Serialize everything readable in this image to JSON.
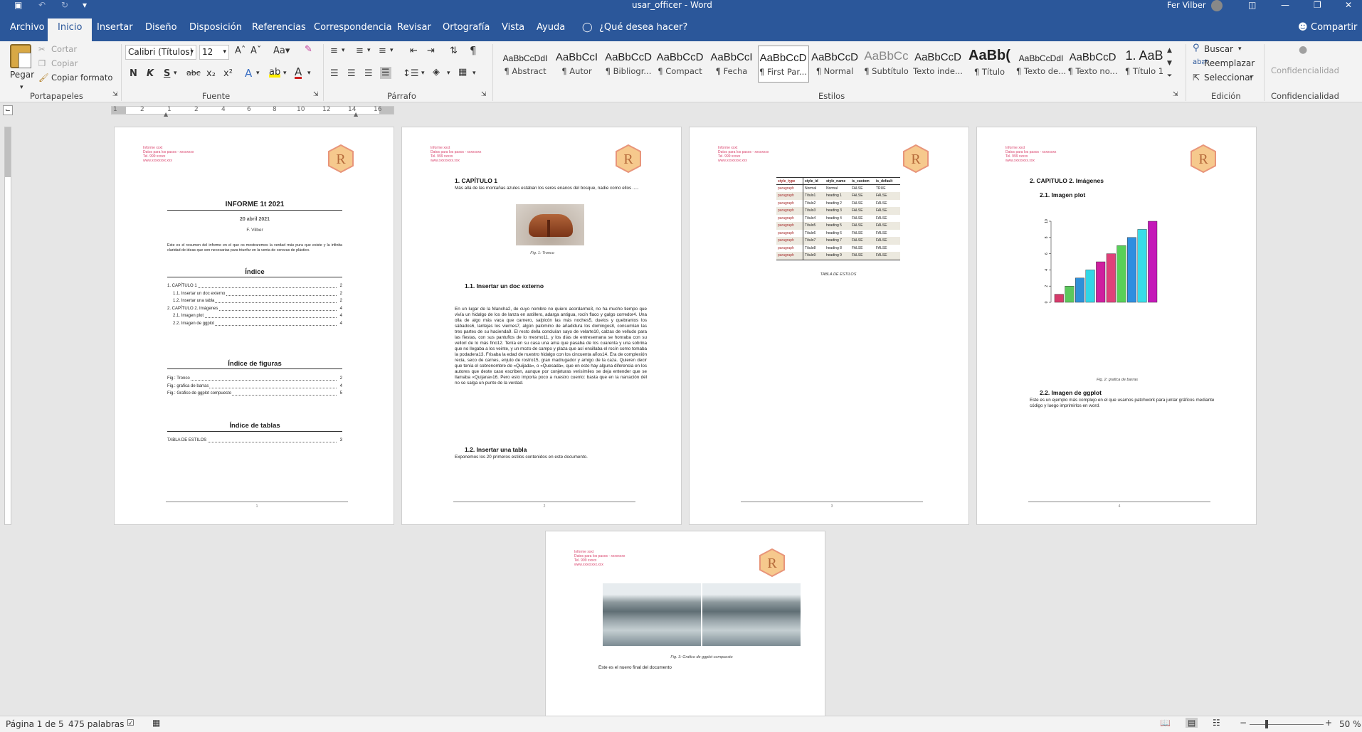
{
  "window": {
    "title": "usar_officer - Word",
    "user": "Fer Vilber"
  },
  "tabs": [
    "Archivo",
    "Inicio",
    "Insertar",
    "Diseño",
    "Disposición",
    "Referencias",
    "Correspondencia",
    "Revisar",
    "Ortografía",
    "Vista",
    "Ayuda"
  ],
  "tell_me": "¿Qué desea hacer?",
  "share": "Compartir",
  "clipboard": {
    "paste": "Pegar",
    "cut": "Cortar",
    "copy": "Copiar",
    "format_painter": "Copiar formato",
    "group": "Portapapeles"
  },
  "font": {
    "name": "Calibri (Títulos)",
    "size": "12",
    "group": "Fuente",
    "bold": "N",
    "italic": "K",
    "underline": "S",
    "strike": "abc",
    "sub": "x₂",
    "sup": "x²"
  },
  "paragraph": {
    "group": "Párrafo"
  },
  "styles": {
    "group": "Estilos",
    "items": [
      {
        "sample": "AaBbCcDdI",
        "name": "¶ Abstract"
      },
      {
        "sample": "AaBbCcI",
        "name": "¶ Autor"
      },
      {
        "sample": "AaBbCcD",
        "name": "¶ Bibliogr..."
      },
      {
        "sample": "AaBbCcD",
        "name": "¶ Compact"
      },
      {
        "sample": "AaBbCcI",
        "name": "¶ Fecha"
      },
      {
        "sample": "AaBbCcD",
        "name": "¶ First Par..."
      },
      {
        "sample": "AaBbCcD",
        "name": "¶ Normal"
      },
      {
        "sample": "AaBbCc",
        "name": "¶ Subtítulo"
      },
      {
        "sample": "AaBbCcD",
        "name": "Texto inde..."
      },
      {
        "sample": "AaBb(",
        "name": "¶ Título"
      },
      {
        "sample": "AaBbCcDdI",
        "name": "¶ Texto de..."
      },
      {
        "sample": "AaBbCcD",
        "name": "¶ Texto no..."
      },
      {
        "sample": "1. AaB",
        "name": "¶ Título 1"
      }
    ]
  },
  "editing": {
    "find": "Buscar",
    "replace": "Reemplazar",
    "select": "Seleccionar",
    "group": "Edición"
  },
  "confidentiality": {
    "label": "Confidencialidad",
    "group": "Confidencialidad"
  },
  "ruler": {
    "marks": [
      "1",
      "2",
      "1",
      "2",
      "4",
      "6",
      "8",
      "10",
      "12",
      "14",
      "16"
    ]
  },
  "doc_header": [
    "Informe xxxt",
    "Datos para los pasos - xxxxxxxx",
    "Tel. 999 xxxxx",
    "www.xxxxxxxx.xxx"
  ],
  "page1": {
    "title": "INFORME 1t 2021",
    "date": "20 abril 2021",
    "author": "F. Vilber",
    "abstract": "Este es el resumen del informe en el que os mostraremos la verdad más pura que existe y la infinita claridad de ideas que son necesarias para triunfar en la venta de cerezas de plástico.",
    "index_title": "Índice",
    "toc": [
      {
        "text": "1.   CAPÍTULO 1",
        "page": "2"
      },
      {
        "text": "1.1.   Insertar un doc externo",
        "page": "2"
      },
      {
        "text": "1.2.   Insertar una tabla",
        "page": "2"
      },
      {
        "text": "2.   CAPÍTULO 2. Imágenes",
        "page": "4"
      },
      {
        "text": "2.1.   Imagen plot",
        "page": "4"
      },
      {
        "text": "2.2.   Imagen de ggplot",
        "page": "4"
      }
    ],
    "fig_index_title": "Índice de figuras",
    "figs": [
      {
        "text": "Fig.: Tronco",
        "page": "2"
      },
      {
        "text": "Fig.: grafica de barras",
        "page": "4"
      },
      {
        "text": "Fig.: Grafico de ggplot compuesto",
        "page": "5"
      }
    ],
    "table_index_title": "Índice de tablas",
    "tables": [
      {
        "text": "TABLA DE ESTILOS",
        "page": "3"
      }
    ],
    "page_num": "1"
  },
  "page2": {
    "h1": "1.   CAPÍTULO 1",
    "intro": "Más allá de las montañas azules estaban los seres enanos del bosque, nadie como ellos .....",
    "fig_caption": "Fig. 1: Tronco",
    "h11": "1.1.        Insertar un doc externo",
    "body": "En un lugar de la Mancha2, de cuyo nombre no quiero acordarme3, no ha mucho tiempo que vivía un hidalgo de los de lanza en astillero, adarga antigua, rocín flaco y galgo corredor4. Una olla de algo más vaca que carnero, salpicón las más noches5, duelos y quebrantos los sábados6, lantejas los viernes7, algún palomino de añadidura los domingos8, consumían las tres partes de su hacienda9. El resto della concluían sayo de velarte10, calzas de velludo para las fiestas, con sus pantuflos de lo mesmo11, y los días de entresemana se honraba con su vellorí de lo más fino12. Tenía en su casa una ama que pasaba de los cuarenta y una sobrina que no llegaba a los veinte, y un mozo de campo y plaza que así ensillaba el rocín como tomaba la podadera13. Frisaba la edad de nuestro hidalgo con los cincuenta años14. Era de complexión recia, seco de carnes, enjuto de rostro15, gran madrugador y amigo de la caza. Quieren decir que tenía el sobrenombre de «Quijada», o «Quesada», que en esto hay alguna diferencia en los autores que deste caso escriben, aunque por conjeturas verisímiles se deja entender que se llamaba «Quijana»16. Pero esto importa poco a nuestro cuento: basta que en la narración dél no se salga un punto de la verdad.",
    "h12": "1.2.        Insertar una tabla",
    "h12_text": "Exponemos los 20 primeros estilos contenidos en este documento.",
    "page_num": "2"
  },
  "page3": {
    "headers": [
      "style_type",
      "style_id",
      "style_name",
      "is_custom",
      "is_default"
    ],
    "rows": [
      [
        "paragraph",
        "Normal",
        "Normal",
        "FALSE",
        "TRUE"
      ],
      [
        "paragraph",
        "Título1",
        "heading 1",
        "FALSE",
        "FALSE"
      ],
      [
        "paragraph",
        "Título2",
        "heading 2",
        "FALSE",
        "FALSE"
      ],
      [
        "paragraph",
        "Título3",
        "heading 3",
        "FALSE",
        "FALSE"
      ],
      [
        "paragraph",
        "Título4",
        "heading 4",
        "FALSE",
        "FALSE"
      ],
      [
        "paragraph",
        "Título5",
        "heading 5",
        "FALSE",
        "FALSE"
      ],
      [
        "paragraph",
        "Título6",
        "heading 6",
        "FALSE",
        "FALSE"
      ],
      [
        "paragraph",
        "Título7",
        "heading 7",
        "FALSE",
        "FALSE"
      ],
      [
        "paragraph",
        "Título8",
        "heading 8",
        "FALSE",
        "FALSE"
      ],
      [
        "paragraph",
        "Título9",
        "heading 9",
        "FALSE",
        "FALSE"
      ]
    ],
    "caption": "TABLA DE ESTILOS",
    "page_num": "3"
  },
  "page4": {
    "h2": "2.   CAPITULO 2. Imágenes",
    "h21": "2.1.        Imagen plot",
    "fig_caption": "Fig. 2: grafica de barras",
    "h22": "2.2.        Imagen de ggplot",
    "h22_text": "Este es un ejemplo más complejo en el que usamos patchwork para juntar gráficos mediante código y luego imprimirlos en word.",
    "page_num": "4"
  },
  "page5": {
    "fig_caption": "Fig. 3: Grafico de ggplot compuesto",
    "final_text": "Este es el nuevo final del documento"
  },
  "chart_data": {
    "type": "bar",
    "categories": [
      "1",
      "2",
      "3",
      "4",
      "5",
      "6",
      "7",
      "8",
      "9",
      "10"
    ],
    "values": [
      1,
      2,
      3,
      4,
      5,
      6,
      7,
      8,
      9,
      10
    ],
    "colors": [
      "#d63a6b",
      "#5cc85c",
      "#2f8fd8",
      "#32d6e6",
      "#cf1f9f",
      "#e0407a",
      "#58d058",
      "#2e8ee0",
      "#38dce8",
      "#c419b8"
    ],
    "ylim": [
      0,
      10
    ],
    "yticks": [
      "0",
      "2",
      "4",
      "6",
      "8",
      "10"
    ]
  },
  "status": {
    "page": "Página 1 de 5",
    "words": "475 palabras",
    "zoom": "50 %"
  }
}
